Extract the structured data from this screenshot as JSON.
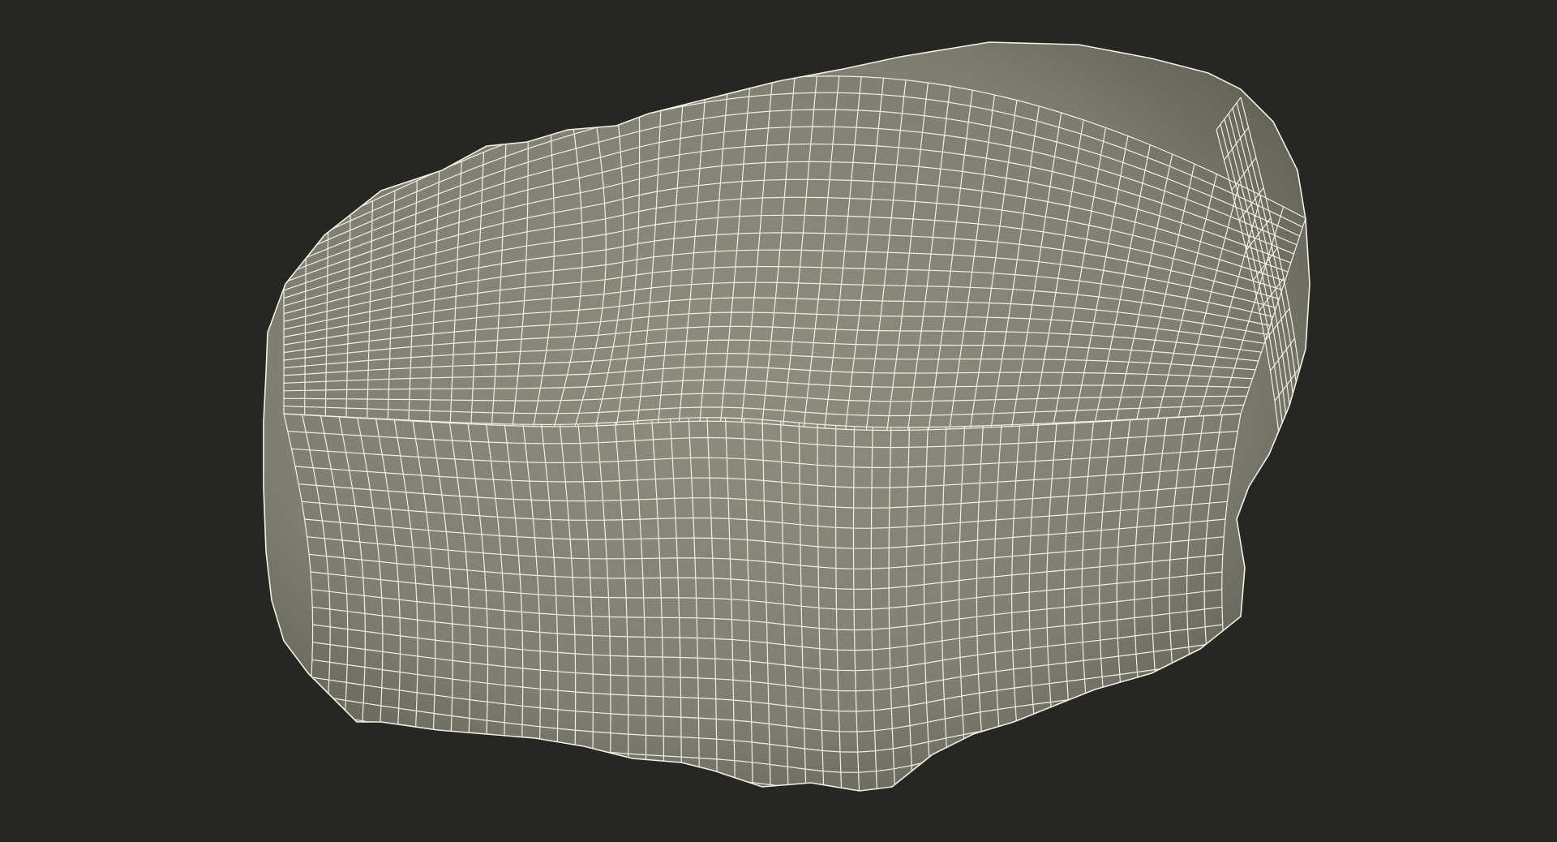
{
  "scene": {
    "subject": "wireframe-mesh-object",
    "background_color": "#262624",
    "surface_color": "#7e7e72",
    "surface_shadow_color": "#5f5f56",
    "surface_highlight_color": "#8d8d80",
    "wire_color": "#f2f0e0"
  }
}
